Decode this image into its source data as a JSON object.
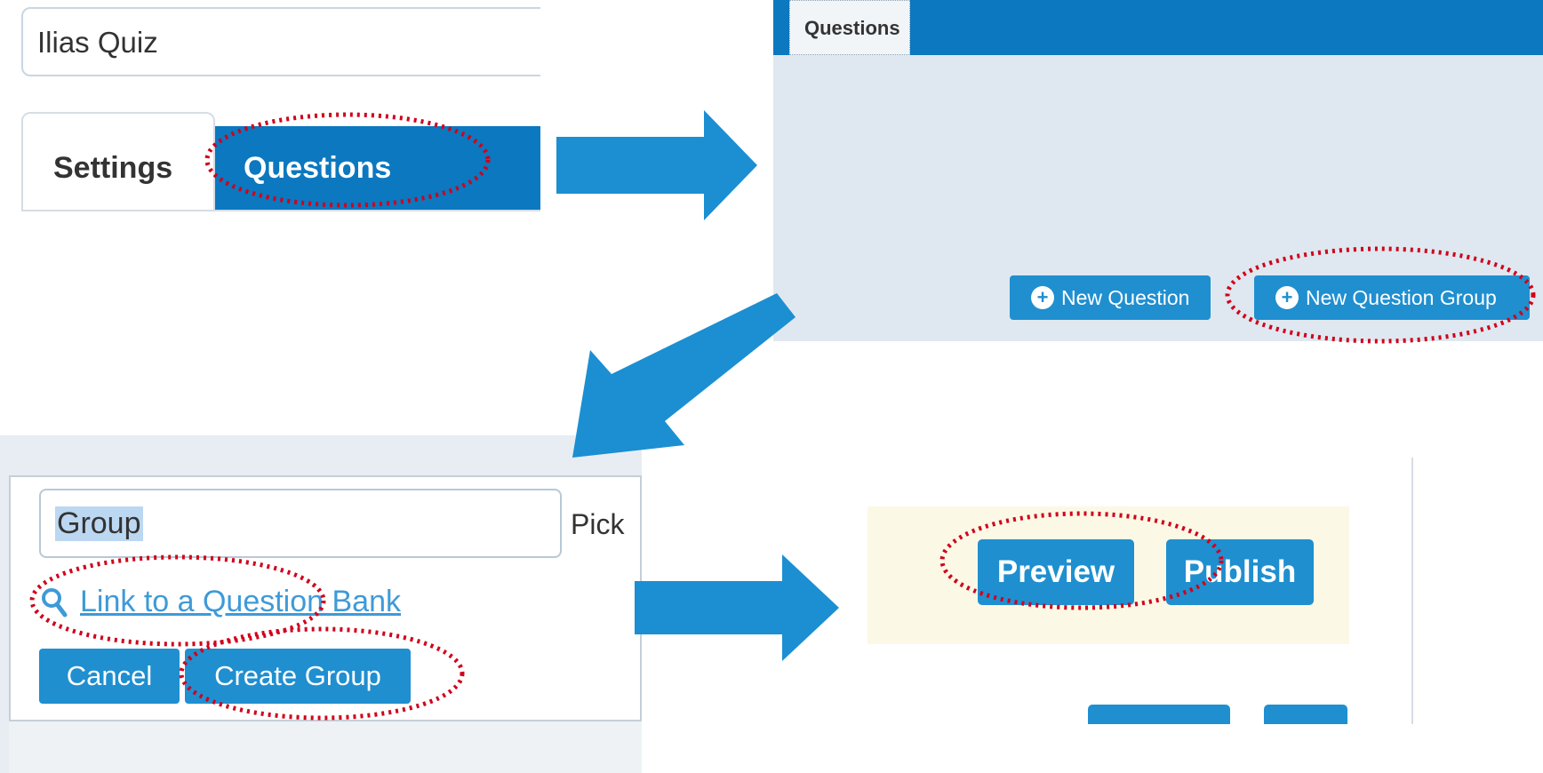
{
  "panel1": {
    "quiz_title": "Ilias Quiz",
    "tabs": [
      {
        "label": "Settings",
        "active": false
      },
      {
        "label": "Questions",
        "active": true
      }
    ]
  },
  "panel2": {
    "tab_label": "Questions",
    "buttons": [
      {
        "label": "New Question",
        "icon": "plus-circle-icon"
      },
      {
        "label": "New Question Group",
        "icon": "plus-circle-icon"
      }
    ]
  },
  "panel3": {
    "group_name_value": "Group",
    "pick_label": "Pick",
    "bank_link_label": "Link to a Question Bank",
    "bank_link_icon": "magnifier-icon",
    "cancel_label": "Cancel",
    "create_group_label": "Create Group"
  },
  "panel4": {
    "preview_label": "Preview",
    "publish_label": "Publish"
  },
  "colors": {
    "accent_blue": "#0b78bf",
    "button_blue": "#1f8fd0",
    "highlight_red": "#d0021b",
    "arrow_blue": "#1b8fd2"
  }
}
